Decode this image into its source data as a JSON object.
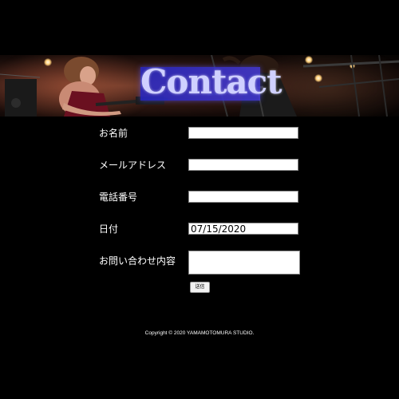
{
  "banner": {
    "title": "Contact"
  },
  "form": {
    "name_label": "お名前",
    "name_value": "",
    "email_label": "メールアドレス",
    "email_value": "",
    "phone_label": "電話番号",
    "phone_value": "",
    "date_label": "日付",
    "date_value": "07/15/2020",
    "inquiry_label": "お問い合わせ内容",
    "inquiry_value": "",
    "submit_label": "送信"
  },
  "footer": {
    "copyright": "Copyright © 2020 YAMAMOTOMURA STUDIO."
  }
}
